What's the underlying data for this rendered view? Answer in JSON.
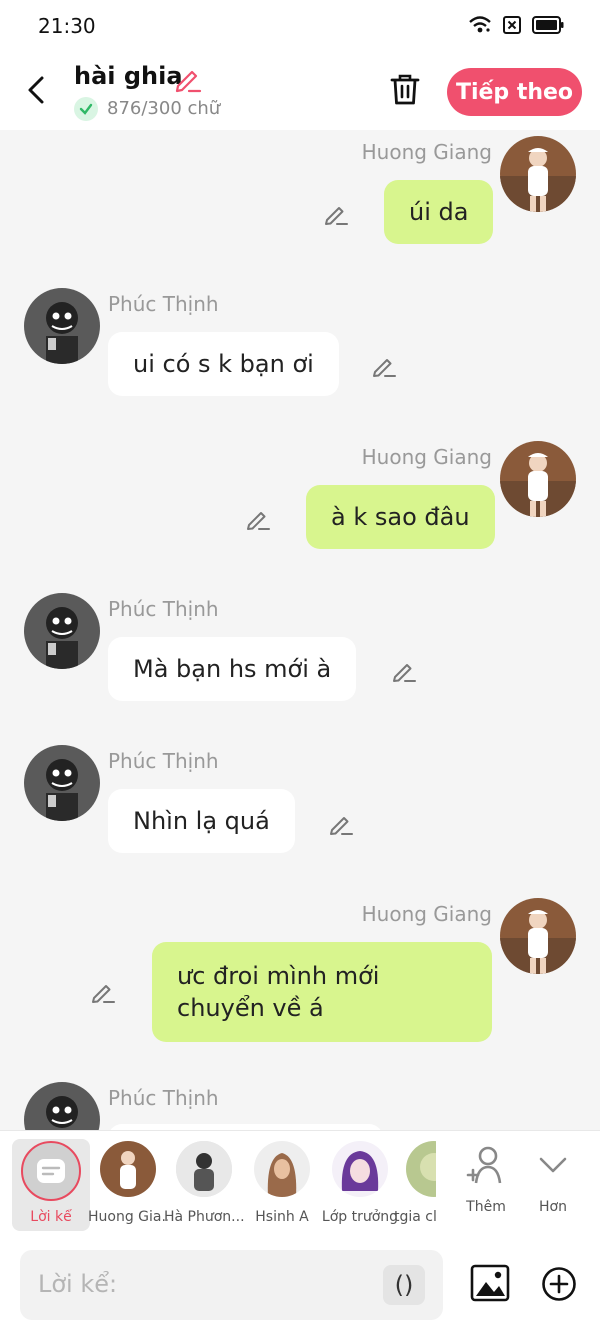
{
  "status": {
    "time": "21:30"
  },
  "header": {
    "title": "hài ghia",
    "word_count": "876/300 chữ",
    "next_label": "Tiếp theo",
    "accent": "#f0506e"
  },
  "messages": [
    {
      "sender": "Huong Giang",
      "side": "right",
      "text": "úi da"
    },
    {
      "sender": "Phúc Thịnh",
      "side": "left",
      "text": "ui có s k bạn ơi"
    },
    {
      "sender": "Huong Giang",
      "side": "right",
      "text": "à k sao đâu"
    },
    {
      "sender": "Phúc Thịnh",
      "side": "left",
      "text": "Mà bạn hs mới à"
    },
    {
      "sender": "Phúc Thịnh",
      "side": "left",
      "text": "Nhìn lạ quá"
    },
    {
      "sender": "Huong Giang",
      "side": "right",
      "text": "ưc đroi mình mới chuyển về á"
    },
    {
      "sender": "Phúc Thịnh",
      "side": "left",
      "text": ""
    }
  ],
  "characters": [
    {
      "label": "Lời kể"
    },
    {
      "label": "Huong Gia..."
    },
    {
      "label": "Hà Phươn..."
    },
    {
      "label": "Hsinh A"
    },
    {
      "label": "Lớp trưởng"
    },
    {
      "label": "tgia cl"
    },
    {
      "label": "Thêm"
    },
    {
      "label": "Hơn"
    }
  ],
  "input": {
    "placeholder": "Lời kể:",
    "paren_label": "()"
  }
}
